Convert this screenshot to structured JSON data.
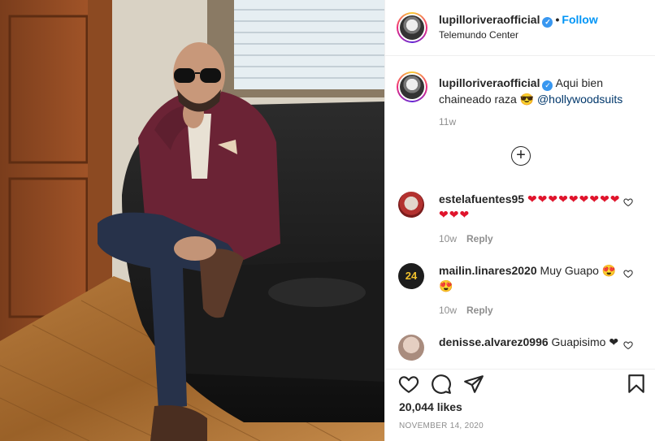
{
  "post": {
    "username": "lupilloriveraofficial",
    "location": "Telemundo Center",
    "follow_label": "Follow",
    "separator": "•"
  },
  "caption": {
    "username": "lupilloriveraofficial",
    "text": "Aqui bien chaineado raza 😎",
    "mention": "@hollywoodsuits",
    "time": "11w"
  },
  "load_more_symbol": "+",
  "comments": [
    {
      "username": "estelafuentes95",
      "text": "❤❤❤❤❤❤❤❤❤❤❤❤",
      "time": "10w",
      "reply_label": "Reply"
    },
    {
      "username": "mailin.linares2020",
      "text": "Muy Guapo 😍😍",
      "time": "10w",
      "reply_label": "Reply"
    },
    {
      "username": "denisse.alvarez0996",
      "text": "Guapisimo ❤"
    }
  ],
  "likes": "20,044 likes",
  "date": "NOVEMBER 14, 2020",
  "icons": {
    "like": "heart-icon",
    "comment": "comment-icon",
    "share": "paper-plane-icon",
    "save": "bookmark-icon"
  },
  "colors": {
    "link": "#0095f6",
    "mention": "#00376b",
    "verified": "#3897f0",
    "heart": "#e0142c",
    "muted": "#8e8e8e"
  }
}
